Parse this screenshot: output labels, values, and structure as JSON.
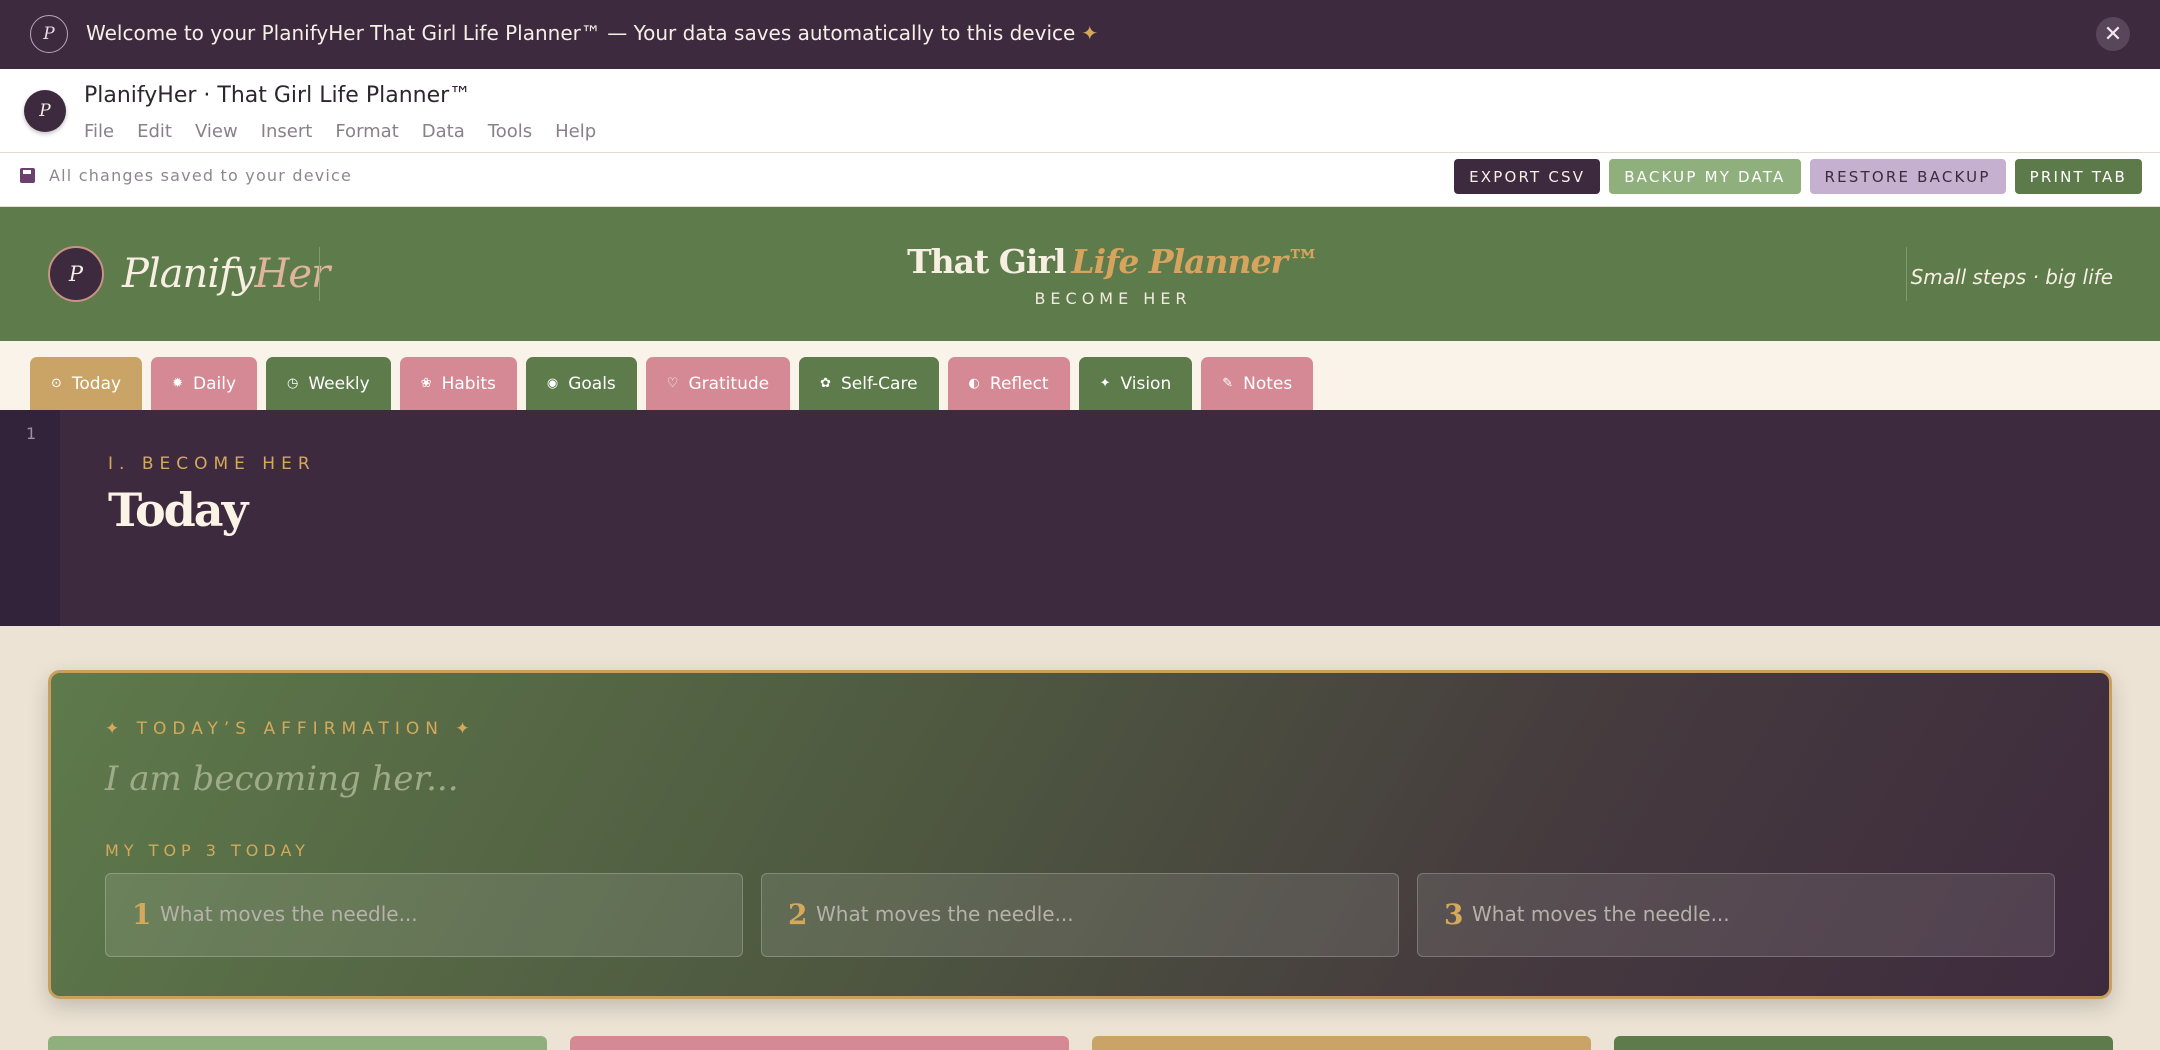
{
  "banner": {
    "logo_letter": "P",
    "message": "Welcome to your PlanifyHer That Girl Life Planner™ — Your data saves automatically to this device",
    "star": "✦",
    "close_glyph": "✕"
  },
  "app": {
    "avatar_letter": "P",
    "title": "PlanifyHer · That Girl Life Planner™",
    "menu": [
      "File",
      "Edit",
      "View",
      "Insert",
      "Format",
      "Data",
      "Tools",
      "Help"
    ]
  },
  "status": {
    "saved_text": "All changes saved to your device",
    "icon": "floppy-disk-icon",
    "actions": {
      "export": "EXPORT CSV",
      "backup": "BACKUP MY DATA",
      "restore": "RESTORE BACKUP",
      "print": "PRINT TAB"
    }
  },
  "brand": {
    "seal_letter": "P",
    "word_a": "Planify",
    "word_b": "Her",
    "title_a": "That Girl",
    "title_b": "Life Planner™",
    "subtitle": "BECOME HER",
    "tagline": "Small steps · big life"
  },
  "tabs": [
    {
      "label": "Today",
      "icon": "⊙"
    },
    {
      "label": "Daily",
      "icon": "✹"
    },
    {
      "label": "Weekly",
      "icon": "◷"
    },
    {
      "label": "Habits",
      "icon": "❀"
    },
    {
      "label": "Goals",
      "icon": "◉"
    },
    {
      "label": "Gratitude",
      "icon": "♡"
    },
    {
      "label": "Self-Care",
      "icon": "✿"
    },
    {
      "label": "Reflect",
      "icon": "◐"
    },
    {
      "label": "Vision",
      "icon": "✦"
    },
    {
      "label": "Notes",
      "icon": "✎"
    }
  ],
  "section": {
    "row_number": "1",
    "eyebrow": "I. BECOME HER",
    "title": "Today"
  },
  "affirmation": {
    "eyebrow": "✦ TODAY’S AFFIRMATION ✦",
    "placeholder": "I am becoming her...",
    "top_label": "MY TOP 3 TODAY",
    "items": [
      {
        "num": "1",
        "placeholder": "What moves the needle..."
      },
      {
        "num": "2",
        "placeholder": "What moves the needle..."
      },
      {
        "num": "3",
        "placeholder": "What moves the needle..."
      }
    ]
  },
  "colors": {
    "plum": "#3d2a3e",
    "sage": "#5e7b4c",
    "gold": "#caa466",
    "rose": "#d48994",
    "cream": "#faf3e9"
  }
}
